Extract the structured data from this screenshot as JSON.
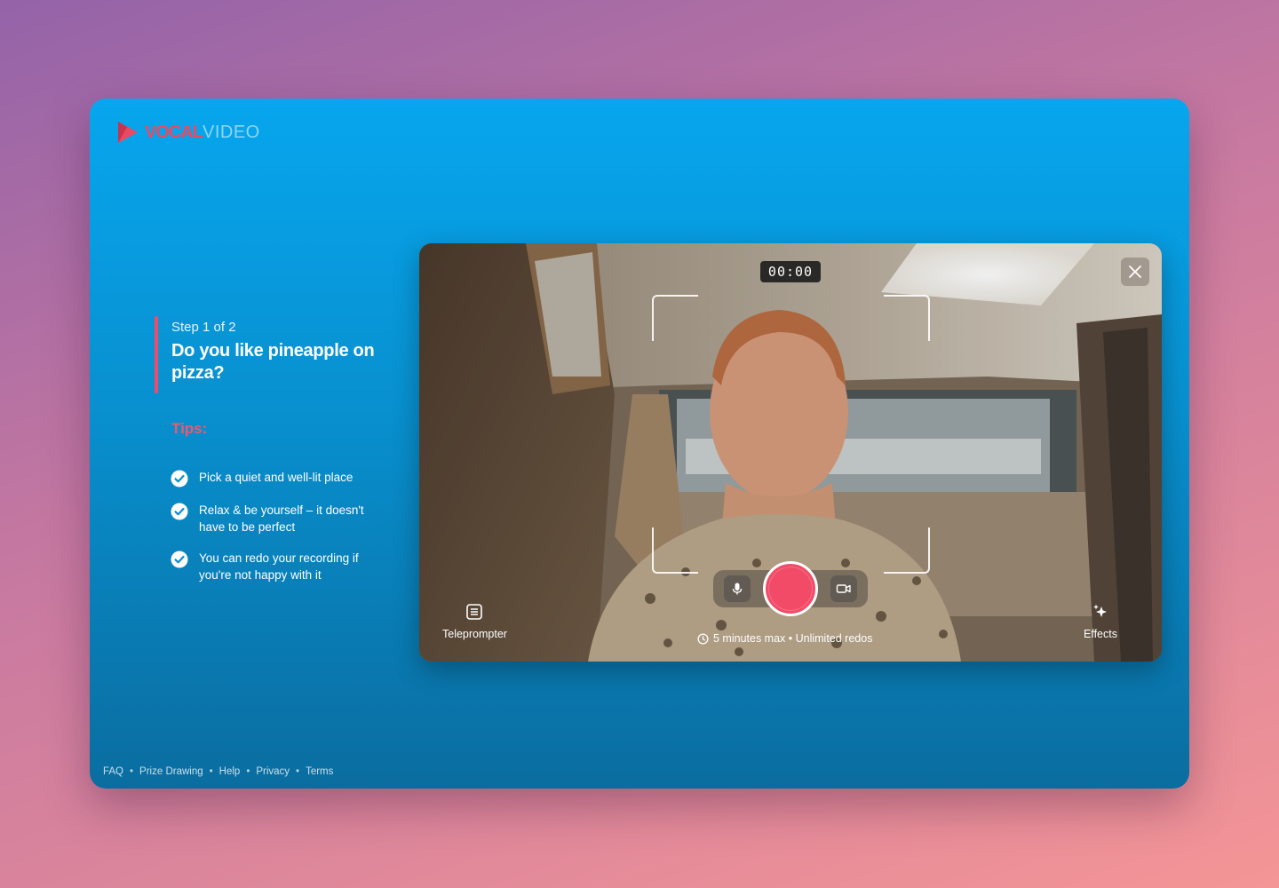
{
  "brand": {
    "logo_part1": "VOCAL",
    "logo_part2": "VIDEO",
    "accent": "#f24b68",
    "icon": "play-triangle-icon"
  },
  "prompt": {
    "step": "Step 1 of 2",
    "question": "Do you like pineapple on pizza?"
  },
  "tips": {
    "title": "Tips:",
    "items": [
      "Pick a quiet and well-lit place",
      "Relax & be yourself – it doesn't have to be perfect",
      "You can redo your recording if you're not happy with it"
    ],
    "icon": "check-circle-icon"
  },
  "footer": {
    "links": [
      "FAQ",
      "Prize Drawing",
      "Help",
      "Privacy",
      "Terms"
    ],
    "separator": "•"
  },
  "recorder": {
    "timer": "00:00",
    "teleprompter_label": "Teleprompter",
    "effects_label": "Effects",
    "limit_text": "5 minutes max • Unlimited redos",
    "record_color": "#f24b68"
  }
}
